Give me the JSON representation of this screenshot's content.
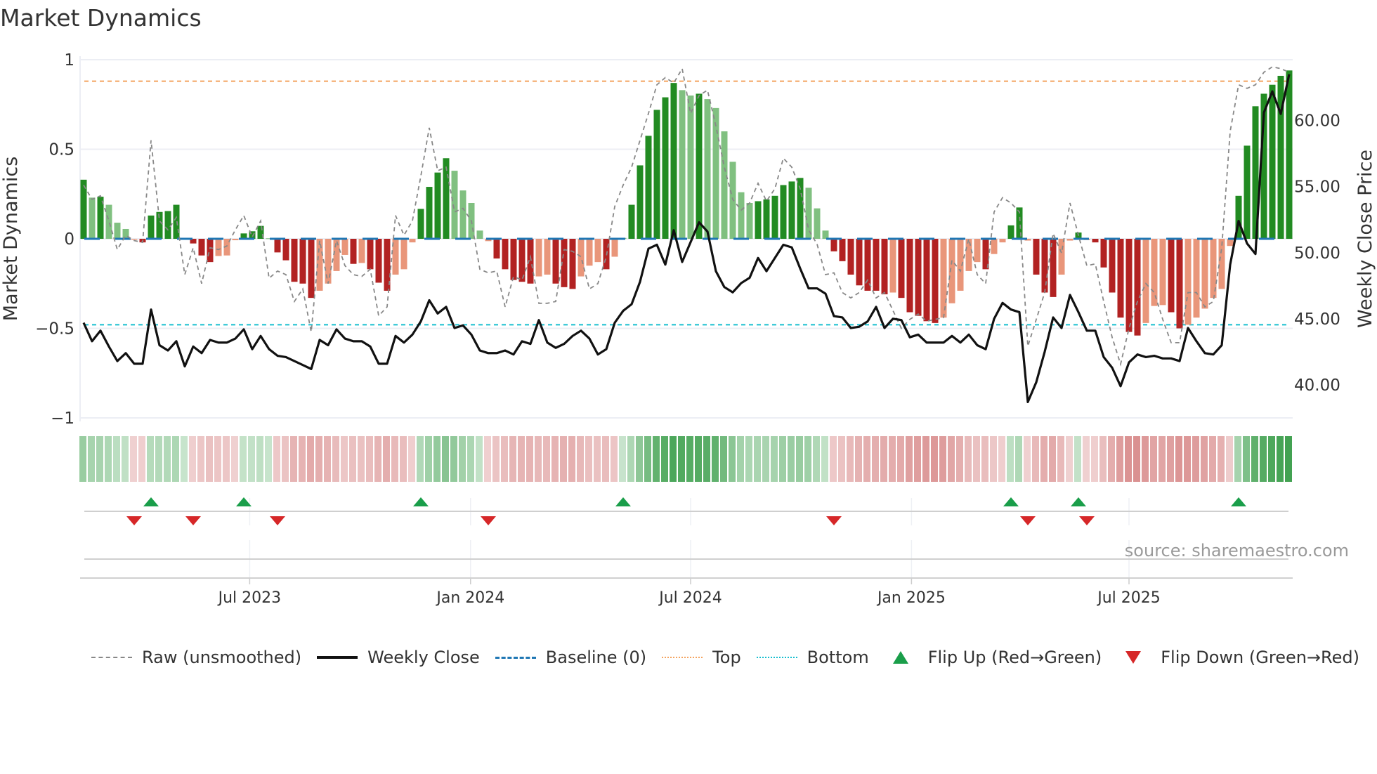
{
  "title": "Market Dynamics",
  "source": "source: sharemaestro.com",
  "colors": {
    "bar_pos_strong": "#228b22",
    "bar_pos_weak": "#80c080",
    "bar_neg_strong": "#b22222",
    "bar_neg_weak": "#e9967a",
    "raw": "#888888",
    "close": "#111111",
    "baseline": "#1f77b4",
    "top": "#f4a460",
    "bottom": "#17becf",
    "flip_up": "#1a9e4a",
    "flip_down": "#d62728",
    "heat_pos": "#3a9e4a",
    "heat_neg": "#c85a5a"
  },
  "legend": [
    {
      "label": "Raw (unsmoothed)",
      "kind": "raw"
    },
    {
      "label": "Weekly Close",
      "kind": "close"
    },
    {
      "label": "Baseline (0)",
      "kind": "baseline"
    },
    {
      "label": "Top",
      "kind": "top"
    },
    {
      "label": "Bottom",
      "kind": "bottom"
    },
    {
      "label": "Flip Up (Red→Green)",
      "kind": "flip_up"
    },
    {
      "label": "Flip Down (Green→Red)",
      "kind": "flip_down"
    }
  ],
  "chart_data": {
    "type": "bar",
    "title": "Market Dynamics",
    "ylabel": "Market Dynamics",
    "ylabel_right": "Weekly Close Price",
    "ylim": [
      -1,
      1
    ],
    "ylim_right": [
      37.5,
      64.6
    ],
    "yticks": [
      {
        "v": 1,
        "label": "1"
      },
      {
        "v": 0.5,
        "label": "0.5"
      },
      {
        "v": 0,
        "label": "0"
      },
      {
        "v": -0.5,
        "label": "−0.5"
      },
      {
        "v": -1,
        "label": "−1"
      }
    ],
    "yticks_right": [
      {
        "v": 60,
        "label": "60.00"
      },
      {
        "v": 55,
        "label": "55.00"
      },
      {
        "v": 50,
        "label": "50.00"
      },
      {
        "v": 45,
        "label": "45.00"
      },
      {
        "v": 40,
        "label": "40.00"
      }
    ],
    "xticks": [
      {
        "week": 20.7,
        "label": "Jul 2023"
      },
      {
        "week": 46.9,
        "label": "Jan 2024"
      },
      {
        "week": 73.0,
        "label": "Jul 2024"
      },
      {
        "week": 99.2,
        "label": "Jan 2025"
      },
      {
        "week": 125.0,
        "label": "Jul 2025"
      }
    ],
    "grid": true,
    "legend_position": "bottom",
    "top_level": 0.88,
    "bottom_level": -0.48,
    "baseline": 0,
    "momentum": [
      0.33,
      0.23,
      0.235,
      0.19,
      0.09,
      0.055,
      -0.005,
      -0.02,
      0.13,
      0.15,
      0.155,
      0.19,
      0.003,
      -0.026,
      -0.093,
      -0.13,
      -0.096,
      -0.093,
      -0.008,
      0.03,
      0.042,
      0.072,
      0.003,
      -0.076,
      -0.12,
      -0.24,
      -0.25,
      -0.33,
      -0.29,
      -0.25,
      -0.18,
      -0.09,
      -0.14,
      -0.135,
      -0.17,
      -0.245,
      -0.29,
      -0.2,
      -0.17,
      -0.02,
      0.167,
      0.29,
      0.37,
      0.45,
      0.38,
      0.27,
      0.2,
      0.046,
      -0.013,
      -0.11,
      -0.17,
      -0.23,
      -0.24,
      -0.25,
      -0.21,
      -0.2,
      -0.25,
      -0.27,
      -0.28,
      -0.21,
      -0.15,
      -0.13,
      -0.17,
      -0.1,
      0.005,
      0.19,
      0.41,
      0.575,
      0.72,
      0.79,
      0.87,
      0.83,
      0.8,
      0.81,
      0.78,
      0.73,
      0.6,
      0.43,
      0.26,
      0.2,
      0.21,
      0.22,
      0.24,
      0.3,
      0.32,
      0.34,
      0.285,
      0.17,
      0.046,
      -0.07,
      -0.125,
      -0.2,
      -0.26,
      -0.29,
      -0.29,
      -0.31,
      -0.3,
      -0.33,
      -0.41,
      -0.43,
      -0.46,
      -0.47,
      -0.44,
      -0.36,
      -0.29,
      -0.18,
      -0.13,
      -0.17,
      -0.085,
      -0.02,
      0.075,
      0.175,
      -0.01,
      -0.2,
      -0.3,
      -0.325,
      -0.2,
      -0.01,
      0.035,
      -0.007,
      -0.02,
      -0.16,
      -0.3,
      -0.44,
      -0.52,
      -0.54,
      -0.47,
      -0.375,
      -0.37,
      -0.41,
      -0.5,
      -0.48,
      -0.44,
      -0.39,
      -0.33,
      -0.28,
      -0.04,
      0.24,
      0.52,
      0.74,
      0.81,
      0.86,
      0.91,
      0.94
    ],
    "raw": [
      0.3,
      0.22,
      0.24,
      0.1,
      -0.06,
      0.02,
      -0.01,
      -0.02,
      0.55,
      0.1,
      0.05,
      0.12,
      -0.2,
      -0.05,
      -0.25,
      -0.05,
      -0.06,
      -0.04,
      0.05,
      0.13,
      0.01,
      0.1,
      -0.22,
      -0.18,
      -0.2,
      -0.35,
      -0.28,
      -0.52,
      -0.01,
      -0.25,
      -0.01,
      -0.15,
      -0.2,
      -0.21,
      -0.17,
      -0.43,
      -0.38,
      0.13,
      0.02,
      0.1,
      0.35,
      0.62,
      0.38,
      0.4,
      0.15,
      0.17,
      0.1,
      -0.17,
      -0.19,
      -0.18,
      -0.38,
      -0.21,
      -0.23,
      -0.1,
      -0.36,
      -0.36,
      -0.35,
      -0.06,
      -0.07,
      -0.1,
      -0.28,
      -0.25,
      -0.1,
      0.18,
      0.3,
      0.4,
      0.55,
      0.7,
      0.86,
      0.9,
      0.87,
      0.95,
      0.7,
      0.8,
      0.83,
      0.63,
      0.4,
      0.22,
      0.16,
      0.2,
      0.31,
      0.21,
      0.28,
      0.45,
      0.4,
      0.28,
      0.05,
      -0.03,
      -0.2,
      -0.19,
      -0.3,
      -0.33,
      -0.3,
      -0.23,
      -0.33,
      -0.3,
      -0.4,
      -0.5,
      -0.45,
      -0.42,
      -0.46,
      -0.45,
      -0.44,
      -0.12,
      -0.18,
      0.0,
      -0.2,
      -0.25,
      0.15,
      0.23,
      0.2,
      0.15,
      -0.6,
      -0.45,
      -0.3,
      0.03,
      -0.08,
      0.2,
      0.02,
      -0.15,
      -0.14,
      -0.35,
      -0.55,
      -0.7,
      -0.5,
      -0.35,
      -0.25,
      -0.3,
      -0.45,
      -0.58,
      -0.58,
      -0.3,
      -0.3,
      -0.38,
      -0.35,
      -0.05,
      0.6,
      0.86,
      0.84,
      0.86,
      0.93,
      0.96,
      0.95,
      0.93
    ],
    "close": [
      44.7,
      43.3,
      44.1,
      42.9,
      41.8,
      42.4,
      41.6,
      41.6,
      45.7,
      43.0,
      42.6,
      43.3,
      41.4,
      42.9,
      42.4,
      43.4,
      43.2,
      43.2,
      43.5,
      44.2,
      42.7,
      43.7,
      42.7,
      42.2,
      42.1,
      41.8,
      41.5,
      41.2,
      43.4,
      43.0,
      44.2,
      43.5,
      43.3,
      43.3,
      42.9,
      41.6,
      41.6,
      43.7,
      43.2,
      43.8,
      44.8,
      46.4,
      45.4,
      45.9,
      44.3,
      44.5,
      43.8,
      42.6,
      42.4,
      42.4,
      42.6,
      42.3,
      43.3,
      43.1,
      44.9,
      43.2,
      42.8,
      43.1,
      43.7,
      44.1,
      43.5,
      42.3,
      42.7,
      44.7,
      45.6,
      46.1,
      47.8,
      50.3,
      50.6,
      49.1,
      51.7,
      49.3,
      50.8,
      52.3,
      51.6,
      48.6,
      47.4,
      47.0,
      47.7,
      48.1,
      49.6,
      48.6,
      49.6,
      50.6,
      50.4,
      48.8,
      47.3,
      47.3,
      46.9,
      45.2,
      45.1,
      44.3,
      44.4,
      44.8,
      45.9,
      44.3,
      45.0,
      44.9,
      43.6,
      43.8,
      43.2,
      43.2,
      43.2,
      43.7,
      43.2,
      43.8,
      43.0,
      42.7,
      45.0,
      46.2,
      45.7,
      45.5,
      38.7,
      40.2,
      42.5,
      45.1,
      44.3,
      46.8,
      45.5,
      44.1,
      44.1,
      42.1,
      41.3,
      39.9,
      41.7,
      42.3,
      42.1,
      42.2,
      42.0,
      42.0,
      41.8,
      44.3,
      43.3,
      42.4,
      42.3,
      43.0,
      49.1,
      52.4,
      50.7,
      49.9,
      60.6,
      62.2,
      60.5,
      63.5
    ],
    "flips_up": [
      9,
      20,
      41,
      65,
      111,
      119,
      138
    ],
    "flips_down": [
      7,
      14,
      24,
      49,
      90,
      113,
      120
    ]
  }
}
